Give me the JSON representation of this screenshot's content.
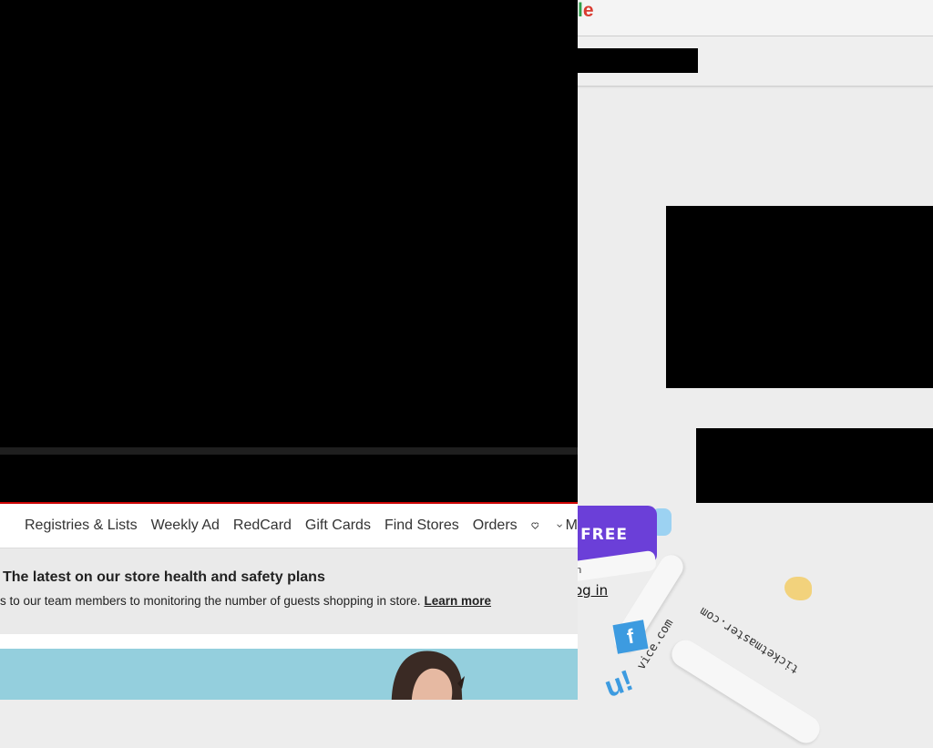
{
  "background_page": {
    "logo_part1": "l",
    "logo_part2": "e",
    "cta_label": "FREE",
    "login_label": "og in",
    "small_text": "n",
    "stickers": {
      "ticketmaster": "ticketmaster.com",
      "vice": "vice.com",
      "facebook_icon_letter": "f",
      "ui_icon_text": "u!"
    },
    "colors": {
      "cta": "#6b3fd8",
      "sticker_blue": "#3d9be0"
    }
  },
  "target_window": {
    "nav": {
      "items": [
        "Registries & Lists",
        "Weekly Ad",
        "RedCard",
        "Gift Cards",
        "Find Stores",
        "Orders"
      ],
      "overflow_label": "M"
    },
    "notice": {
      "title": "The latest on our store health and safety plans",
      "text": "s to our team members to monitoring the number of guests shopping in store.",
      "link": "Learn more"
    },
    "colors": {
      "accent": "#cc0000",
      "hero_bg": "#94cfdd"
    }
  }
}
